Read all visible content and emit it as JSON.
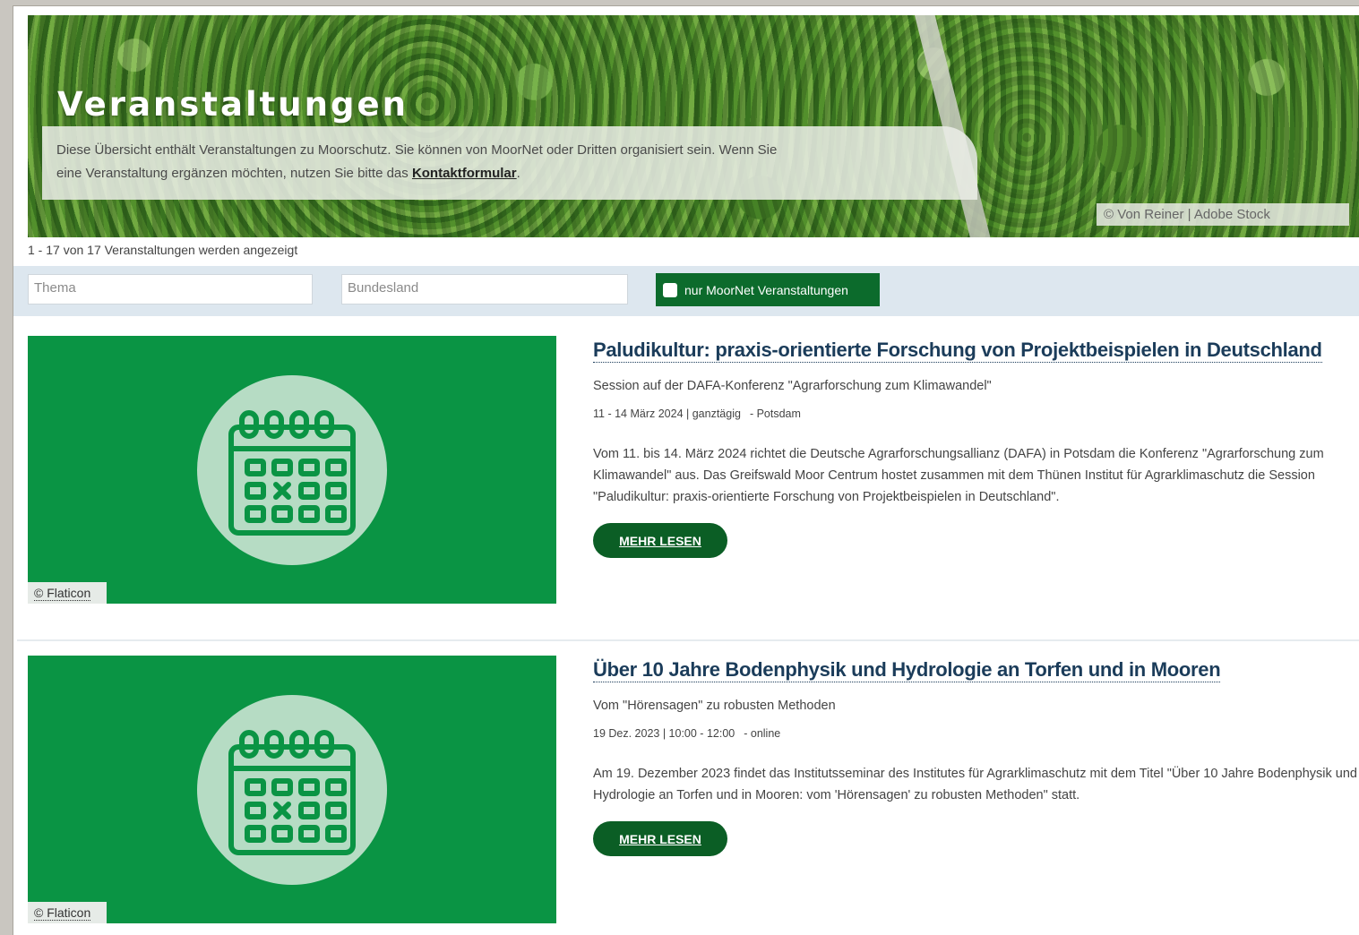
{
  "hero": {
    "title": "Veranstaltungen",
    "intro": "Diese Übersicht enthält Veranstaltungen zu Moorschutz. Sie können von MoorNet oder Dritten organisiert sein. Wenn Sie eine Veranstaltung ergänzen möchten, nutzen Sie bitte das ",
    "contact_link": "Kontaktformular",
    "intro_end": ".",
    "credit": "© Von Reiner | Adobe Stock"
  },
  "results": {
    "count_text": "1 - 17 von 17 Veranstaltungen werden angezeigt"
  },
  "filters": {
    "thema_placeholder": "Thema",
    "bundesland_placeholder": "Bundesland",
    "moornet_only_label": "nur MoorNet Veranstaltungen",
    "moornet_only_checked": false
  },
  "events": [
    {
      "image_credit": "© Flaticon",
      "title": "Paludikultur: praxis-orientierte Forschung von Projektbeispielen in Deutschland",
      "subtitle": "Session auf der DAFA-Konferenz \"Agrarforschung zum Klimawandel\"",
      "date": "11 - 14 März 2024 | ganztägig",
      "location": "- Potsdam",
      "description": "Vom 11. bis 14. März 2024 richtet die Deutsche Agrarforschungsallianz (DAFA) in Potsdam die Konferenz \"Agrarforschung zum Klimawandel\" aus. Das Greifswald Moor Centrum hostet zusammen mit dem Thünen Institut für Agrarklimaschutz die Session \"Paludikultur: praxis-orientierte Forschung von Projektbeispielen in Deutschland\".",
      "button": "MEHR LESEN"
    },
    {
      "image_credit": "© Flaticon",
      "title": "Über 10 Jahre Bodenphysik und Hydrologie an Torfen und in Mooren",
      "subtitle": "Vom \"Hörensagen\" zu robusten Methoden",
      "date": "19 Dez. 2023 | 10:00 - 12:00",
      "location": "- online",
      "description": "Am 19. Dezember 2023 findet das Institutsseminar des Institutes für Agrarklimaschutz mit dem Titel \"Über 10 Jahre Bodenphysik und Hydrologie an Torfen und in Mooren: vom 'Hörensagen' zu robusten Methoden\" statt.",
      "button": "MEHR LESEN"
    }
  ],
  "colors": {
    "brand_green": "#0c6b2c",
    "thumbnail_green": "#0a9444",
    "filter_bar": "#dde7ef",
    "title_blue": "#1b3c5a"
  },
  "icons": [
    "calendar-icon",
    "checkbox-icon"
  ]
}
